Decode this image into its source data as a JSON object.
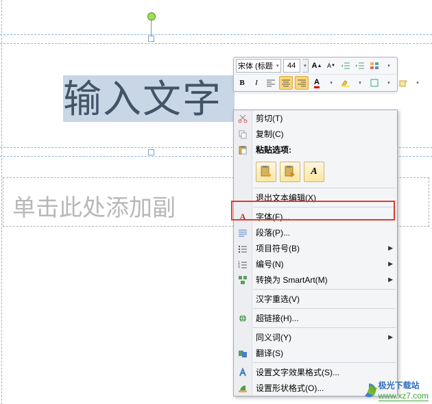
{
  "title_text": "输入文字",
  "subtitle_text": "单击此处添加副",
  "mini_toolbar": {
    "font_name": "宋体 (标题",
    "font_size": "44"
  },
  "context_menu": {
    "cut": "剪切(T)",
    "copy": "复制(C)",
    "paste_opts_label": "粘贴选项:",
    "exit_text_edit": "退出文本编辑(X)",
    "font": "字体(F)...",
    "paragraph": "段落(P)...",
    "bullets": "项目符号(B)",
    "numbering": "编号(N)",
    "smartart": "转换为 SmartArt(M)",
    "chinese_relayout": "汉字重选(V)",
    "hyperlink": "超链接(H)...",
    "synonyms": "同义词(Y)",
    "translate": "翻译(S)",
    "text_effects": "设置文字效果格式(S)...",
    "shape_format": "设置形状格式(O)..."
  },
  "watermark": {
    "brand": "极光下载站",
    "url": "www.xz7.com"
  }
}
